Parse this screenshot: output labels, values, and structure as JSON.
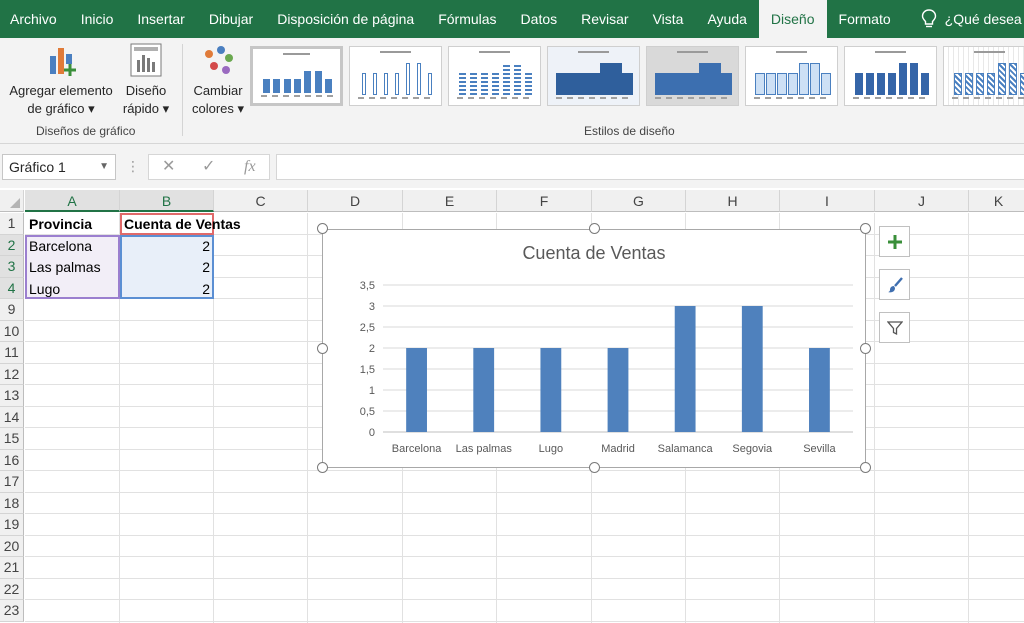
{
  "menu": {
    "tabs": [
      "Archivo",
      "Inicio",
      "Insertar",
      "Dibujar",
      "Disposición de página",
      "Fórmulas",
      "Datos",
      "Revisar",
      "Vista",
      "Ayuda",
      "Diseño",
      "Formato"
    ],
    "active_tab": "Diseño",
    "tell_me": "¿Qué desea ha"
  },
  "ribbon": {
    "add_element": [
      "Agregar elemento",
      "de gráfico ▾"
    ],
    "quick_layout": [
      "Diseño",
      "rápido ▾"
    ],
    "change_colors": [
      "Cambiar",
      "colores ▾"
    ],
    "group_layouts": "Diseños de gráfico",
    "group_styles": "Estilos de diseño",
    "style_count": 8,
    "selected_style": 1
  },
  "formula_bar": {
    "name_box": "Gráfico 1",
    "fx": "fx",
    "value": ""
  },
  "grid": {
    "columns": [
      "A",
      "B",
      "C",
      "D",
      "E",
      "F",
      "G",
      "H",
      "I",
      "J",
      "K"
    ],
    "rows": [
      "1",
      "2",
      "3",
      "4",
      "9",
      "10",
      "11",
      "12",
      "13",
      "14",
      "15",
      "16",
      "17",
      "18",
      "19",
      "20",
      "21",
      "22",
      "23"
    ],
    "table": {
      "headers": [
        "Provincia",
        "Cuenta de Ventas"
      ],
      "rows": [
        [
          "Barcelona",
          "2"
        ],
        [
          "Las palmas",
          "2"
        ],
        [
          "Lugo",
          "2"
        ]
      ]
    }
  },
  "colors": {
    "excel_green": "#217346",
    "bar": "#4f81bd",
    "plus_icon": "#3a8f3a"
  },
  "chart_data": {
    "type": "bar",
    "title": "Cuenta de Ventas",
    "categories": [
      "Barcelona",
      "Las palmas",
      "Lugo",
      "Madrid",
      "Salamanca",
      "Segovia",
      "Sevilla"
    ],
    "values": [
      2,
      2,
      2,
      2,
      3,
      3,
      2
    ],
    "ylim": [
      0,
      3.5
    ],
    "yticks": [
      "0",
      "0,5",
      "1",
      "1,5",
      "2",
      "2,5",
      "3",
      "3,5"
    ],
    "grid": true,
    "legend": "none"
  },
  "chart_side_buttons": [
    "plus-icon",
    "brush-icon",
    "filter-icon"
  ]
}
